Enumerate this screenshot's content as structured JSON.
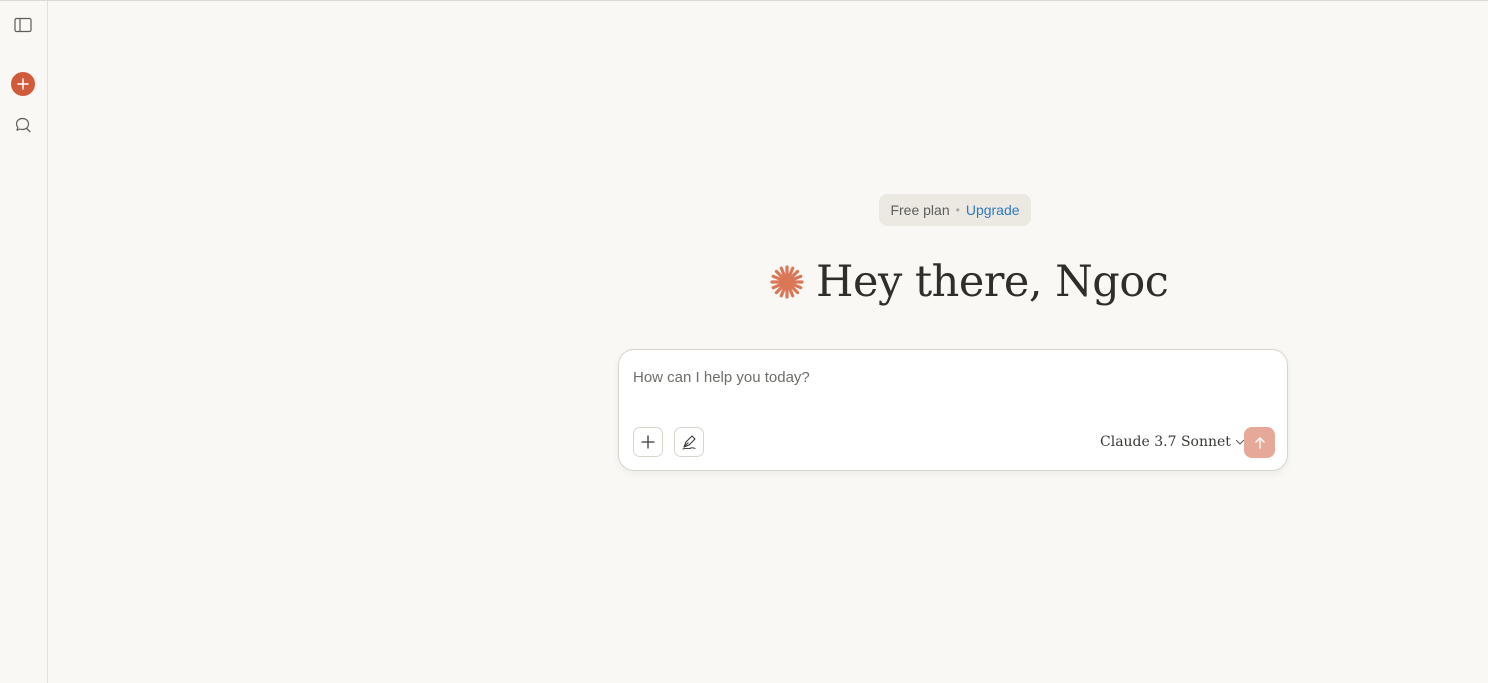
{
  "plan": {
    "label": "Free plan",
    "separator": "•",
    "upgrade_label": "Upgrade"
  },
  "greeting": {
    "text": "Hey there, Ngoc"
  },
  "composer": {
    "placeholder": "How can I help you today?",
    "model_label": "Claude 3.7 Sonnet"
  },
  "icons": {
    "sidebar_toggle": "sidebar-toggle-icon",
    "new_chat": "plus-circle-icon",
    "search": "search-chat-icon",
    "logo": "claude-spark-icon",
    "attach": "plus-icon",
    "style": "pen-nib-icon",
    "model_dropdown": "chevron-down-icon",
    "send": "arrow-up-icon"
  },
  "colors": {
    "accent": "#d15a3a",
    "link": "#2e7ac2",
    "send_disabled": "#e6a898",
    "background": "#f9f8f5"
  }
}
